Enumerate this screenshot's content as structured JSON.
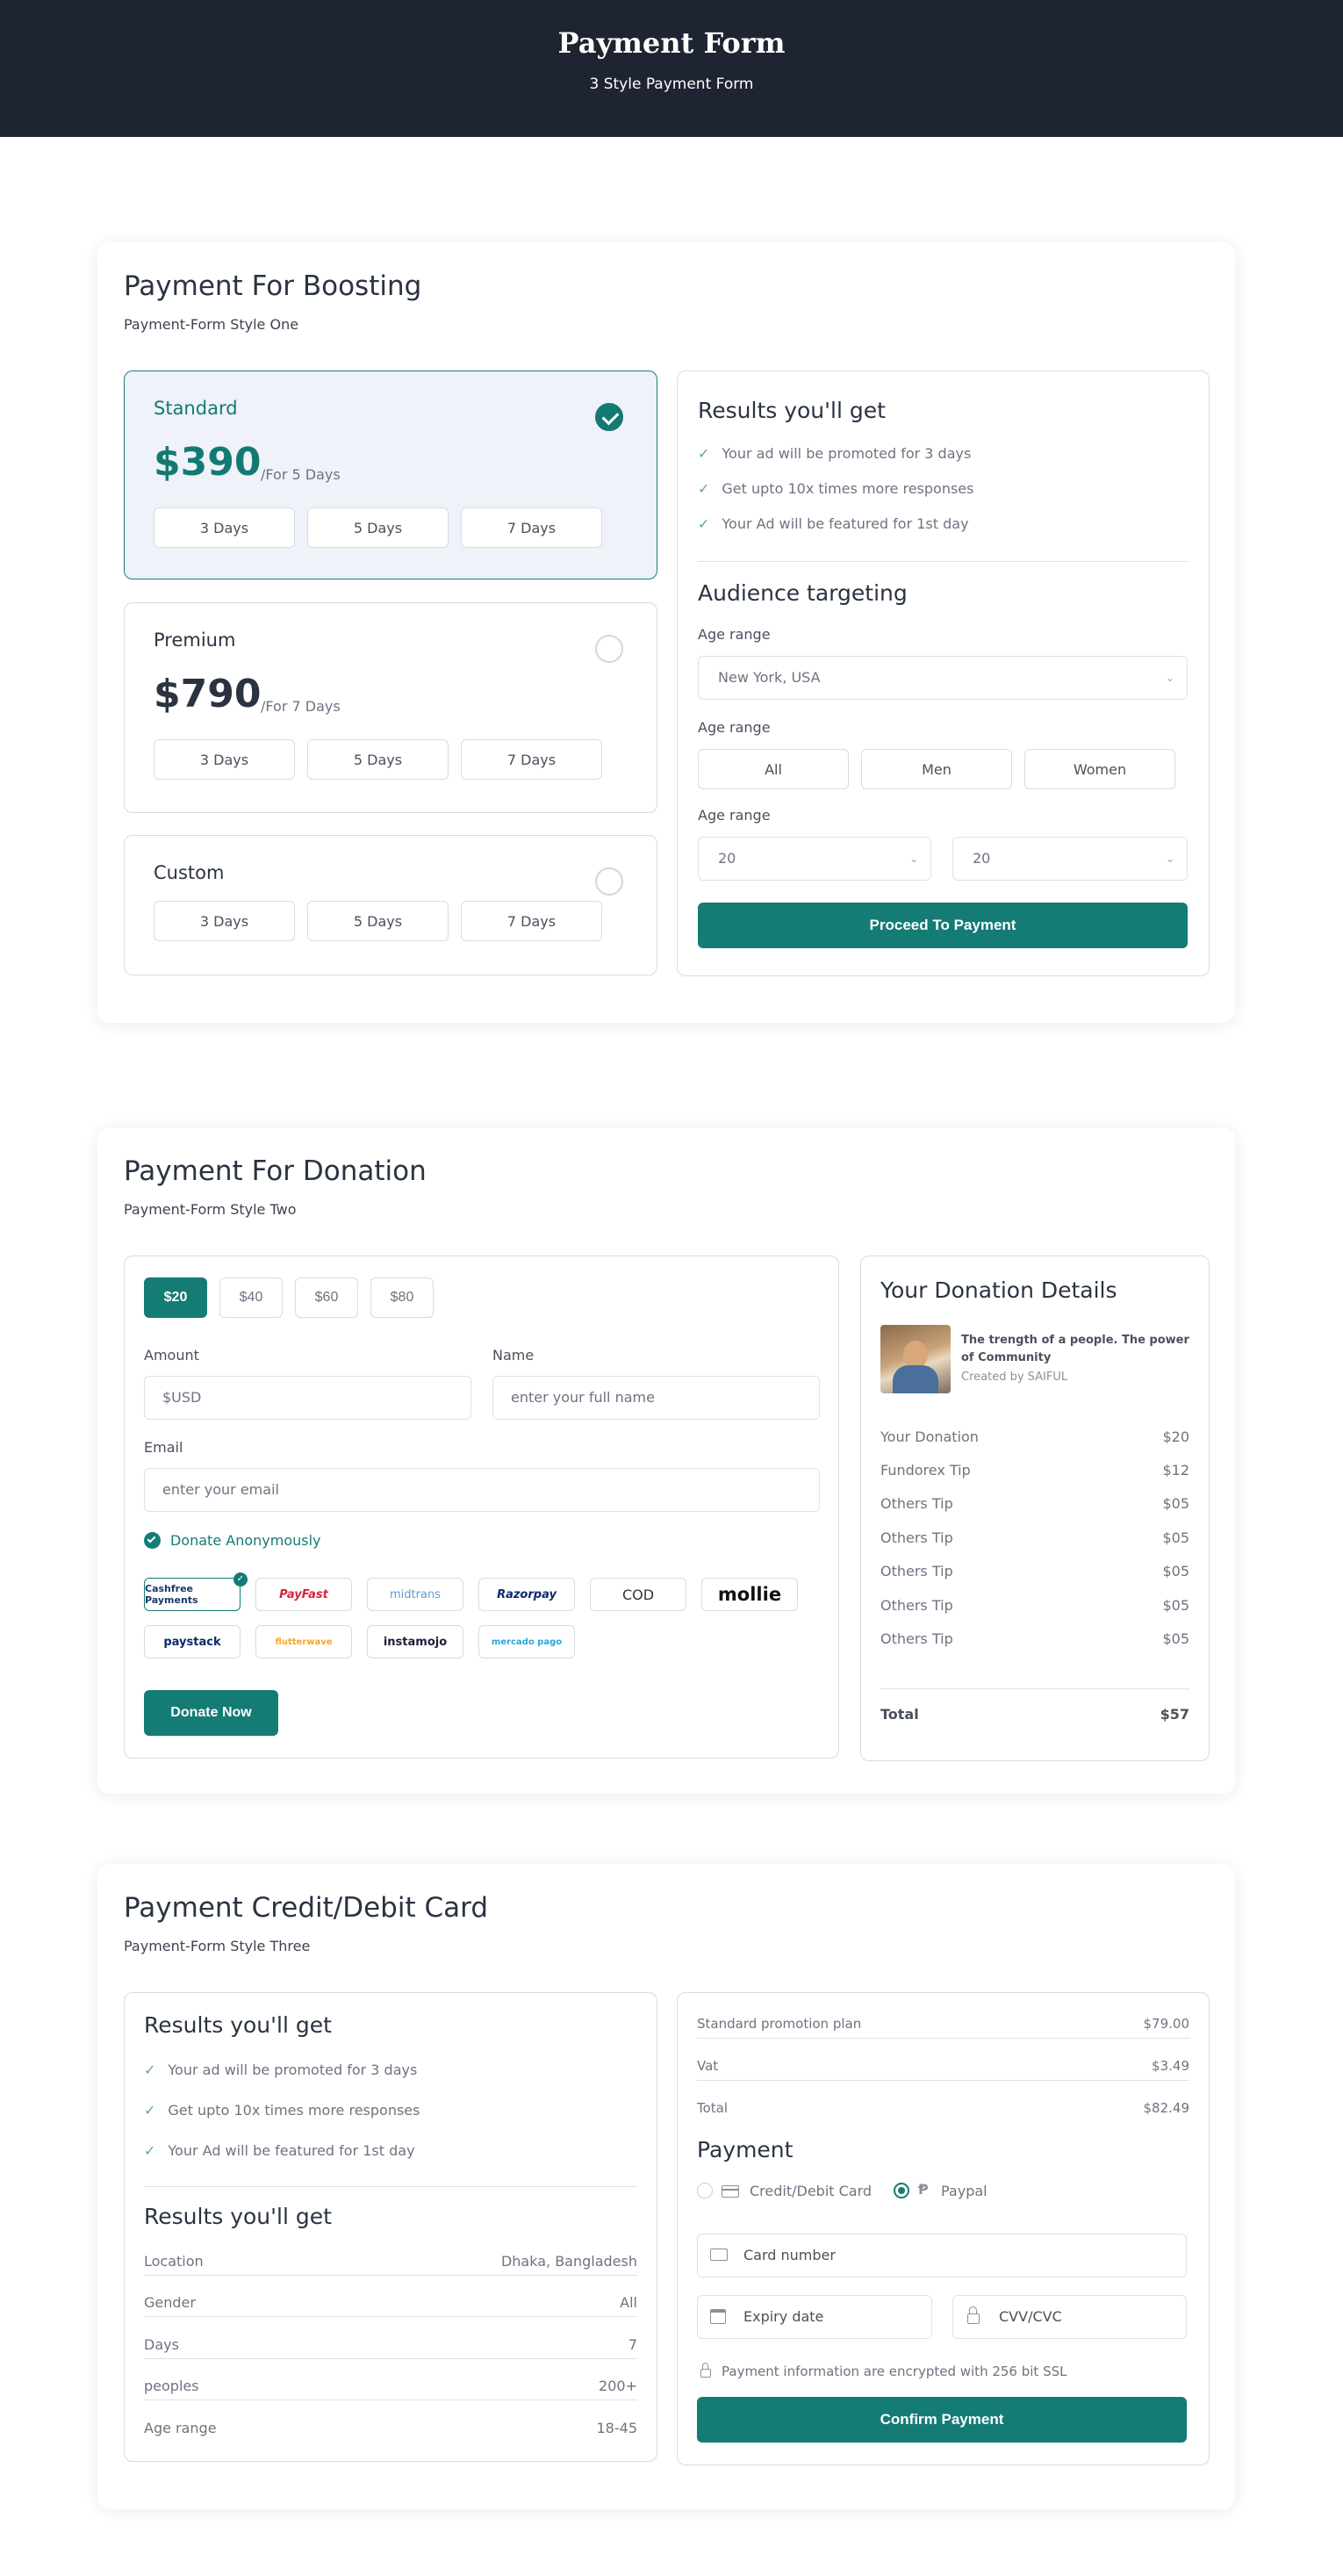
{
  "header": {
    "title": "Payment Form",
    "subtitle": "3 Style Payment Form"
  },
  "boosting": {
    "title": "Payment For Boosting",
    "subtitle": "Payment-Form Style One",
    "plans": [
      {
        "name": "Standard",
        "price": "$390",
        "per": "/For 5 Days",
        "days": [
          "3 Days",
          "5 Days",
          "7 Days"
        ]
      },
      {
        "name": "Premium",
        "price": "$790",
        "per": "/For 7 Days",
        "days": [
          "3 Days",
          "5 Days",
          "7 Days"
        ]
      },
      {
        "name": "Custom",
        "days": [
          "3 Days",
          "5 Days",
          "7 Days"
        ]
      }
    ],
    "results": {
      "title": "Results you'll get",
      "items": [
        "Your ad will be promoted for 3 days",
        "Get upto 10x times more responses",
        "Your Ad will be featured for 1st day"
      ]
    },
    "audience": {
      "title": "Audience targeting",
      "age_label_1": "Age range",
      "location": "New York, USA",
      "age_label_2": "Age range",
      "genders": [
        "All",
        "Men",
        "Women"
      ],
      "age_label_3": "Age range",
      "age_from": "20",
      "age_to": "20"
    },
    "proceed": "Proceed To Payment"
  },
  "donation": {
    "title": "Payment For Donation",
    "subtitle": "Payment-Form Style Two",
    "amounts": [
      "$20",
      "$40",
      "$60",
      "$80"
    ],
    "amount_label": "Amount",
    "amount_placeholder": "$USD",
    "name_label": "Name",
    "name_placeholder": "enter your full name",
    "email_label": "Email",
    "email_placeholder": "enter your email",
    "anon": "Donate Anonymously",
    "gateways_row1": [
      "Cashfree Payments",
      "PayFast",
      "midtrans",
      "Razorpay",
      "COD",
      "mollie"
    ],
    "gateways_row2": [
      "paystack",
      "flutterwave",
      "instamojo",
      "mercado pago"
    ],
    "donate_btn": "Donate Now",
    "details": {
      "title": "Your Donation Details",
      "campaign": "The trength of a people. The power of Community",
      "creator": "Created by SAIFUL",
      "rows": [
        {
          "label": "Your Donation",
          "value": "$20"
        },
        {
          "label": "Fundorex Tip",
          "value": "$12"
        },
        {
          "label": "Others Tip",
          "value": "$05"
        },
        {
          "label": "Others Tip",
          "value": "$05"
        },
        {
          "label": "Others Tip",
          "value": "$05"
        },
        {
          "label": "Others Tip",
          "value": "$05"
        },
        {
          "label": "Others Tip",
          "value": "$05"
        }
      ],
      "total_label": "Total",
      "total_value": "$57"
    }
  },
  "card": {
    "title": "Payment Credit/Debit Card",
    "subtitle": "Payment-Form Style Three",
    "results": {
      "title": "Results you'll get",
      "items": [
        "Your ad will be promoted for 3 days",
        "Get upto 10x times more responses",
        "Your Ad will be featured for 1st day"
      ]
    },
    "results2": {
      "title": "Results you'll get",
      "rows": [
        {
          "label": "Location",
          "value": "Dhaka, Bangladesh"
        },
        {
          "label": "Gender",
          "value": "All"
        },
        {
          "label": "Days",
          "value": "7"
        },
        {
          "label": "peoples",
          "value": "200+"
        },
        {
          "label": "Age range",
          "value": "18-45"
        }
      ]
    },
    "summary": [
      {
        "label": "Standard promotion plan",
        "value": "$79.00"
      },
      {
        "label": "Vat",
        "value": "$3.49"
      },
      {
        "label": "Total",
        "value": "$82.49"
      }
    ],
    "payment_title": "Payment",
    "method_card": "Credit/Debit Card",
    "method_paypal": "Paypal",
    "card_number": "Card number",
    "expiry": "Expiry date",
    "cvv": "CVV/CVC",
    "ssl": "Payment information are encrypted with 256 bit SSL",
    "confirm": "Confirm Payment"
  },
  "colors": {
    "primary": "#147b75",
    "header_bg": "#1f2432",
    "selected_bg": "#eff2f9"
  }
}
